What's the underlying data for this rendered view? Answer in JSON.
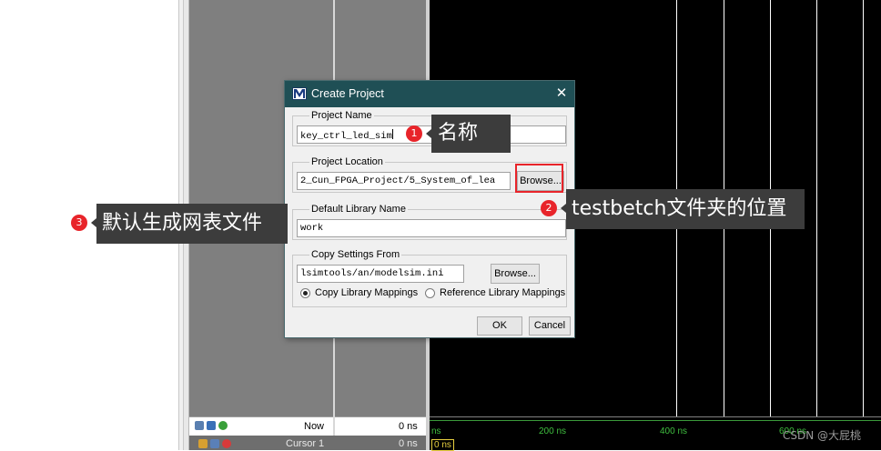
{
  "dialog": {
    "title": "Create Project",
    "close_glyph": "✕",
    "project_name": {
      "label": "Project Name",
      "value": "key_ctrl_led_sim"
    },
    "project_location": {
      "label": "Project Location",
      "value": "2_Cun_FPGA_Project/5_System_of_lea",
      "browse_label": "Browse..."
    },
    "default_library": {
      "label": "Default Library Name",
      "value": "work"
    },
    "copy_settings": {
      "label": "Copy Settings From",
      "value": "lsimtools/an/modelsim.ini",
      "browse_label": "Browse...",
      "radio_copy": "Copy Library Mappings",
      "radio_reference": "Reference Library Mappings",
      "selected": "copy"
    },
    "ok_label": "OK",
    "cancel_label": "Cancel"
  },
  "wave": {
    "now_label": "Now",
    "now_value": "0 ns",
    "cursor_label": "Cursor 1",
    "cursor_value": "0 ns",
    "ruler": [
      "ns",
      "200 ns",
      "400 ns",
      "600 ns"
    ],
    "cursor_marker": "0 ns",
    "icons": [
      "wave-sim-icon",
      "monitor-icon",
      "add-cursor-icon",
      "lock-icon",
      "wrench-icon",
      "remove-cursor-icon"
    ]
  },
  "annotations": [
    {
      "badge": "1",
      "text": "名称"
    },
    {
      "badge": "2",
      "text": "testbetch文件夹的位置"
    },
    {
      "badge": "3",
      "text": "默认生成网表文件"
    }
  ],
  "watermark": "CSDN @大屁桃",
  "colors": {
    "titlebar": "#1f4f55",
    "badge": "#e8242a",
    "callout": "#3c3c3c",
    "wave_bg": "#000000",
    "ruler_green": "#3fbf3f"
  }
}
